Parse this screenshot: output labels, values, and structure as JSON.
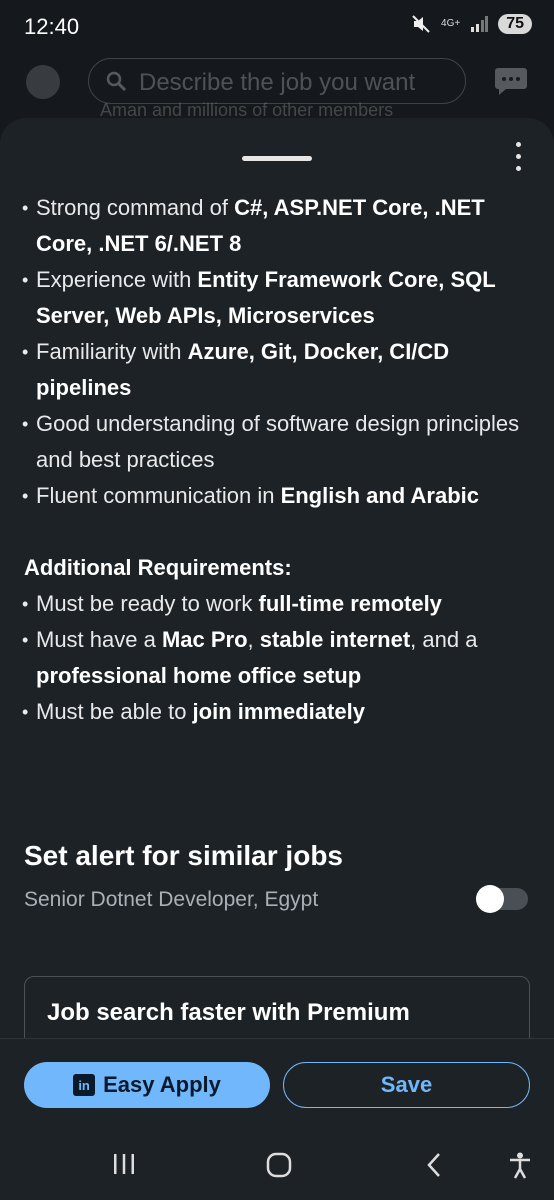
{
  "status": {
    "time": "12:40",
    "network": "4G+",
    "battery": "75"
  },
  "search": {
    "placeholder": "Describe the job you want",
    "peek_text": "Aman and millions of other members"
  },
  "requirements": [
    {
      "parts": [
        {
          "t": "Strong command of ",
          "b": false
        },
        {
          "t": "C#, ASP.NET Core, .NET Core, .NET 6/.NET 8",
          "b": true
        }
      ]
    },
    {
      "parts": [
        {
          "t": "Experience with ",
          "b": false
        },
        {
          "t": "Entity Framework Core, SQL Server, Web APIs, Microservices",
          "b": true
        }
      ]
    },
    {
      "parts": [
        {
          "t": "Familiarity with ",
          "b": false
        },
        {
          "t": "Azure, Git, Docker, CI/CD pipelines",
          "b": true
        }
      ]
    },
    {
      "parts": [
        {
          "t": "Good understanding of software design principles and best practices",
          "b": false
        }
      ]
    },
    {
      "parts": [
        {
          "t": "Fluent communication in ",
          "b": false
        },
        {
          "t": "English and Arabic",
          "b": true
        }
      ]
    }
  ],
  "additional": {
    "heading": "Additional Requirements:",
    "items": [
      {
        "parts": [
          {
            "t": "Must be ready to work ",
            "b": false
          },
          {
            "t": "full-time remotely",
            "b": true
          }
        ]
      },
      {
        "parts": [
          {
            "t": "Must have a ",
            "b": false
          },
          {
            "t": "Mac Pro",
            "b": true
          },
          {
            "t": ", ",
            "b": false
          },
          {
            "t": "stable internet",
            "b": true
          },
          {
            "t": ", and a ",
            "b": false
          },
          {
            "t": "professional home office setup",
            "b": true
          }
        ]
      },
      {
        "parts": [
          {
            "t": "Must be able to ",
            "b": false
          },
          {
            "t": "join immediately",
            "b": true
          }
        ]
      }
    ]
  },
  "alert": {
    "title": "Set alert for similar jobs",
    "subtitle": "Senior Dotnet Developer, Egypt",
    "enabled": false
  },
  "premium": {
    "title": "Job search faster with Premium"
  },
  "actions": {
    "apply_label": "Easy Apply",
    "apply_badge": "in",
    "save_label": "Save"
  },
  "colors": {
    "accent": "#71b7fb",
    "sheet_bg": "#1d2226",
    "background": "#15181c"
  }
}
